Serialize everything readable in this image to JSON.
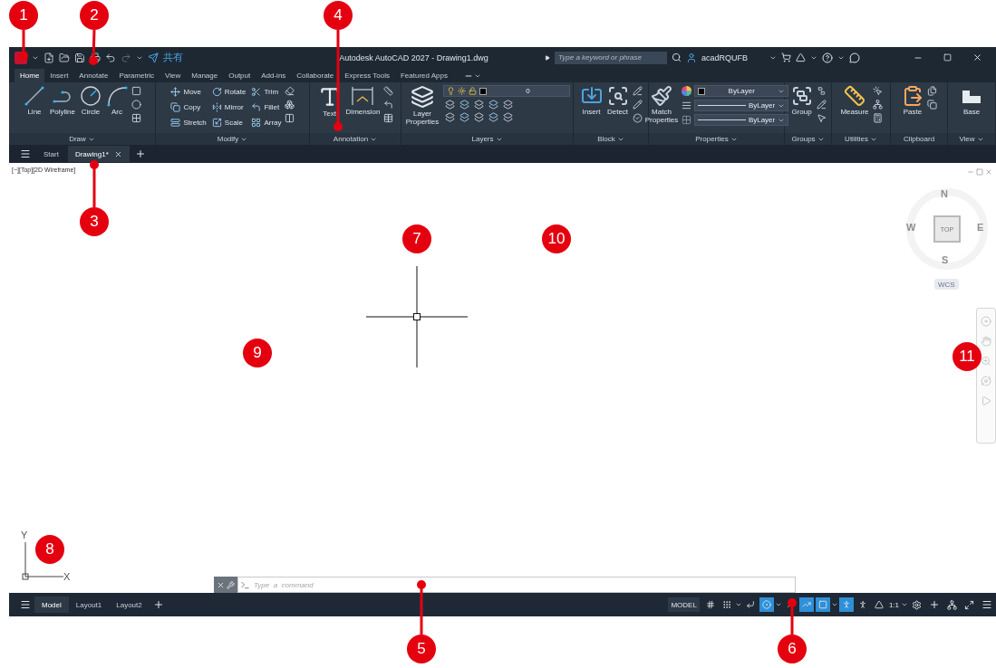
{
  "title_bar": {
    "share_label": "共有",
    "title": "Autodesk AutoCAD 2027 - Drawing1.dwg",
    "search": {
      "placeholder": "Type a keyword or phrase"
    },
    "user": "acadRQUFB"
  },
  "ribbon_tabs": [
    {
      "label": "Home",
      "selected": true
    },
    {
      "label": "Insert",
      "selected": false
    },
    {
      "label": "Annotate",
      "selected": false
    },
    {
      "label": "Parametric",
      "selected": false
    },
    {
      "label": "View",
      "selected": false
    },
    {
      "label": "Manage",
      "selected": false
    },
    {
      "label": "Output",
      "selected": false
    },
    {
      "label": "Add-ins",
      "selected": false
    },
    {
      "label": "Collaborate",
      "selected": false
    },
    {
      "label": "Express Tools",
      "selected": false
    },
    {
      "label": "Featured Apps",
      "selected": false
    }
  ],
  "ribbon_panels": [
    {
      "title": "Draw",
      "menu": true,
      "items": [
        {
          "kind": "large",
          "label": "Line"
        },
        {
          "kind": "large",
          "label": "Polyline"
        },
        {
          "kind": "large",
          "label": "Circle"
        },
        {
          "kind": "large",
          "label": "Arc"
        }
      ]
    },
    {
      "title": "Modify",
      "menu": true,
      "items": [
        {
          "kind": "small",
          "label": "Move"
        },
        {
          "kind": "small",
          "label": "Rotate"
        },
        {
          "kind": "small",
          "label": "Trim"
        },
        {
          "kind": "small",
          "label": "Copy"
        },
        {
          "kind": "small",
          "label": "Mirror"
        },
        {
          "kind": "small",
          "label": "Fillet"
        },
        {
          "kind": "small",
          "label": "Stretch"
        },
        {
          "kind": "small",
          "label": "Scale"
        },
        {
          "kind": "small",
          "label": "Array"
        }
      ]
    },
    {
      "title": "Annotation",
      "menu": true,
      "items": [
        {
          "kind": "large",
          "label": "Text"
        },
        {
          "kind": "large",
          "label": "Dimension"
        }
      ]
    },
    {
      "title": "Layers",
      "menu": true,
      "items": [
        {
          "kind": "large",
          "label": "Layer Properties"
        },
        {
          "kind": "dropdown",
          "value": "0"
        }
      ]
    },
    {
      "title": "Block",
      "menu": true,
      "items": [
        {
          "kind": "large",
          "label": "Insert"
        },
        {
          "kind": "large",
          "label": "Detect"
        }
      ]
    },
    {
      "title": "Properties",
      "menu": true,
      "items": [
        {
          "kind": "large",
          "label": "Match Properties"
        },
        {
          "kind": "dropdown",
          "value": "ByLayer"
        },
        {
          "kind": "dropdown",
          "value": "ByLayer"
        },
        {
          "kind": "dropdown",
          "value": "ByLayer"
        }
      ]
    },
    {
      "title": "Groups",
      "menu": true,
      "items": [
        {
          "kind": "large",
          "label": "Group"
        }
      ]
    },
    {
      "title": "Utilities",
      "menu": true,
      "items": [
        {
          "kind": "large",
          "label": "Measure"
        }
      ]
    },
    {
      "title": "Clipboard",
      "menu": false,
      "items": [
        {
          "kind": "large",
          "label": "Paste"
        }
      ]
    },
    {
      "title": "View",
      "menu": true,
      "items": [
        {
          "kind": "large",
          "label": "Base"
        }
      ]
    }
  ],
  "file_tabs": [
    {
      "label": "Start",
      "selected": false
    },
    {
      "label": "Drawing1*",
      "selected": true
    }
  ],
  "viewport_label": "[−][Top][2D Wireframe]",
  "viewcube": {
    "north": "N",
    "west": "W",
    "east": "E",
    "south": "S",
    "face": "TOP",
    "ucs": "WCS"
  },
  "ucs_icon": {
    "y_label": "Y",
    "x_label": "X"
  },
  "command_line": {
    "placeholder": "Type  a  command"
  },
  "layout_tabs": [
    {
      "label": "Model",
      "selected": true
    },
    {
      "label": "Layout1",
      "selected": false
    },
    {
      "label": "Layout2",
      "selected": false
    }
  ],
  "status_bar": {
    "space_label": "MODEL",
    "scale": "1:1",
    "toggles": [
      {
        "on": false
      },
      {
        "on": false
      },
      {
        "on": false
      },
      {
        "on": true
      },
      {
        "on": false
      },
      {
        "on": true
      },
      {
        "on": true
      },
      {
        "on": true
      },
      {
        "on": false
      },
      {
        "on": false
      }
    ]
  },
  "callouts": [
    {
      "number": "1"
    },
    {
      "number": "2"
    },
    {
      "number": "3"
    },
    {
      "number": "4"
    },
    {
      "number": "5"
    },
    {
      "number": "6"
    },
    {
      "number": "7"
    },
    {
      "number": "8"
    },
    {
      "number": "9"
    },
    {
      "number": "10"
    },
    {
      "number": "11"
    }
  ]
}
